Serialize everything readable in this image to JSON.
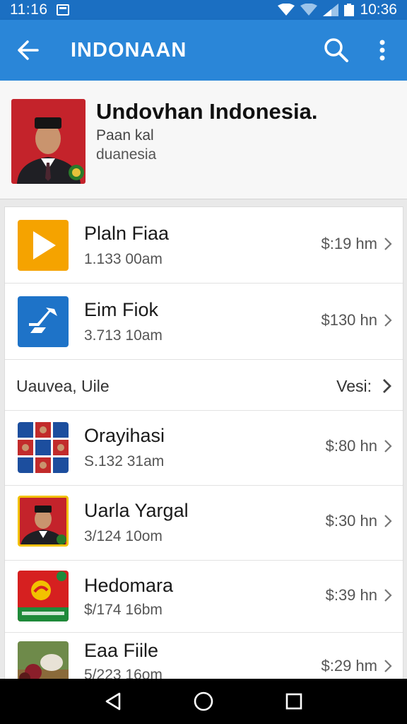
{
  "status_bar": {
    "time_left": "11:16",
    "time_right": "10:36"
  },
  "app_bar": {
    "title": "INDONAAN"
  },
  "profile": {
    "name": "Undovhan Indonesia.",
    "line1": "Paan kal",
    "line2": "duanesia"
  },
  "items": [
    {
      "title": "Plaln Fiaa",
      "subtitle": "1.133 00am",
      "price": "$:19 hm",
      "icon": "play-icon",
      "icon_color": "#f5a300"
    },
    {
      "title": "Eim Fiok",
      "subtitle": "3.713 10am",
      "price": "$130 hn",
      "icon": "app-arrow-icon",
      "icon_color": "#1e73c8"
    }
  ],
  "section": {
    "label": "Uauvea, Uile",
    "more": "Vesi:"
  },
  "items2": [
    {
      "title": "Orayihasi",
      "subtitle": "S.132 31am",
      "price": "$:80 hn",
      "icon": "photo-grid-icon"
    },
    {
      "title": "Uarla Yargal",
      "subtitle": "3/124 10om",
      "price": "$:30 hn",
      "icon": "portrait-icon"
    },
    {
      "title": "Hedomara",
      "subtitle": "$/174 16bm",
      "price": "$:39 hn",
      "icon": "party-logo-icon"
    },
    {
      "title": "Eaa Fiile",
      "subtitle": "5/223 16om",
      "price": "$:29 hm",
      "icon": "animal-photo-icon"
    }
  ],
  "colors": {
    "appbar": "#2a86d8",
    "statusbar": "#1b6fc2",
    "play": "#f5a300",
    "blue_tile": "#1e73c8"
  }
}
